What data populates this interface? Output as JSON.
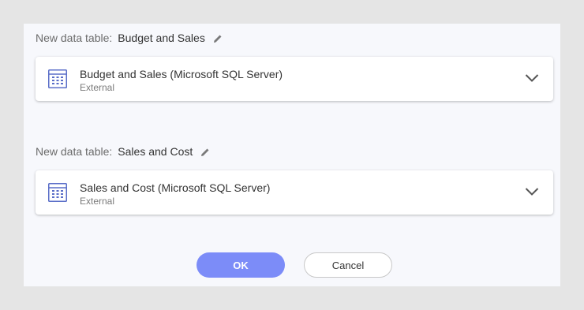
{
  "tables": [
    {
      "label_prefix": "New data table:",
      "name": "Budget and Sales",
      "source_title": "Budget and Sales (Microsoft SQL Server)",
      "source_type": "External"
    },
    {
      "label_prefix": "New data table:",
      "name": "Sales and Cost",
      "source_title": "Sales and Cost (Microsoft SQL Server)",
      "source_type": "External"
    }
  ],
  "buttons": {
    "ok_label": "OK",
    "cancel_label": "Cancel"
  },
  "colors": {
    "ok_button": "#7c8cf8",
    "icon_blue": "#5a6ec8",
    "background": "#f7f8fc"
  },
  "icons": {
    "edit": "pencil-icon",
    "table": "table-icon",
    "expand": "chevron-down-icon"
  }
}
